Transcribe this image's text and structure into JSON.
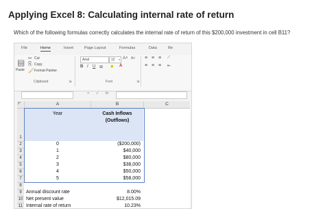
{
  "page": {
    "title": "Applying Excel 8: Calculating internal rate of return",
    "question": "Which of the following formulas correctly calculates the internal rate of return of this $200,000 investment in cell B11?"
  },
  "ribbon": {
    "tabs": [
      "File",
      "Home",
      "Insert",
      "Page Layout",
      "Formulas",
      "Data",
      "Re"
    ],
    "clipboard": {
      "paste": "Paste",
      "cut": "Cut",
      "copy": "Copy",
      "format_painter": "Format Painter",
      "group_label": "Clipboard"
    },
    "font": {
      "name": "Arial",
      "size": "12",
      "group_label": "Font"
    }
  },
  "formula_bar": {
    "fx": "fx",
    "cancel": "×",
    "enter": "✓"
  },
  "sheet": {
    "columns": [
      "A",
      "B",
      "C"
    ],
    "rows": [
      "1",
      "2",
      "3",
      "4",
      "5",
      "6",
      "7",
      "8",
      "9",
      "10",
      "11"
    ],
    "header_a": "Year",
    "header_b_line1": "Cash Inflows",
    "header_b_line2": "(Outflows)",
    "years": [
      "0",
      "1",
      "2",
      "3",
      "4",
      "5"
    ],
    "cash_flows": [
      "($200,000)",
      "$40,000",
      "$80,000",
      "$38,000",
      "$50,000",
      "$58,000"
    ],
    "summary": [
      {
        "label": "Annual discount rate",
        "value": "8.00%"
      },
      {
        "label": "Net present value",
        "value": "$12,015.09"
      },
      {
        "label": "Internal rate of return",
        "value": "10.23%"
      }
    ]
  }
}
